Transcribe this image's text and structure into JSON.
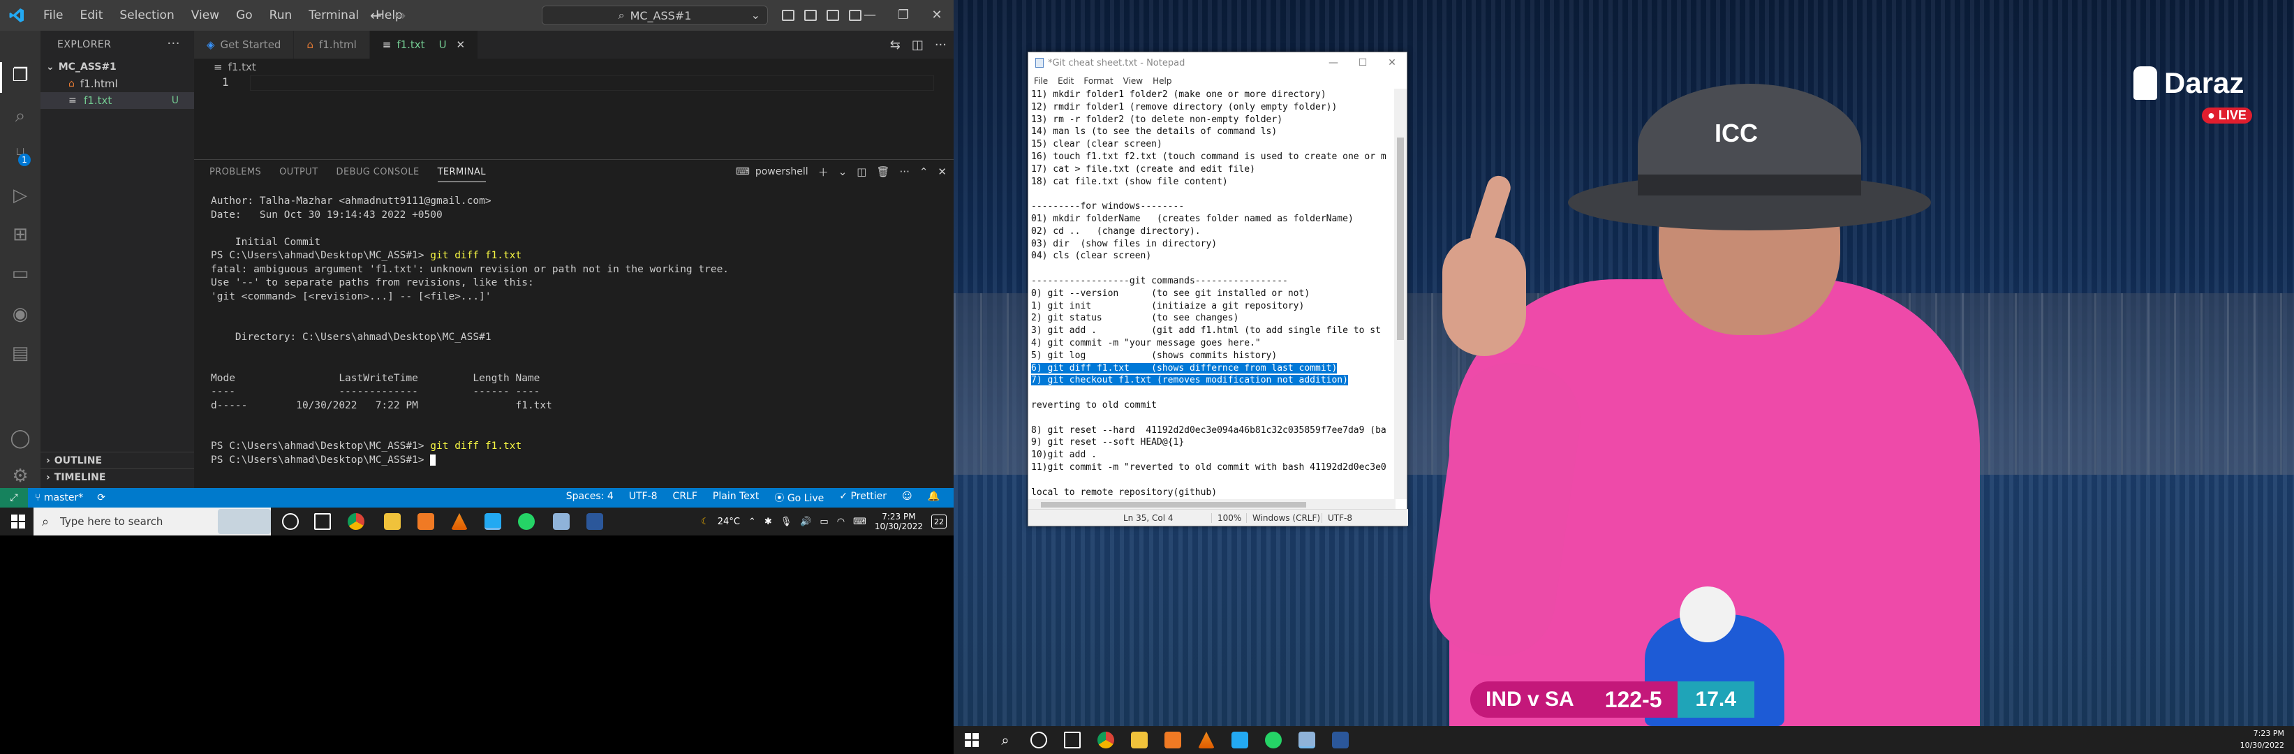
{
  "vscode": {
    "menu": [
      "File",
      "Edit",
      "Selection",
      "View",
      "Go",
      "Run",
      "Terminal",
      "Help"
    ],
    "search_text": "MC_ASS#1",
    "explorer_label": "EXPLORER",
    "folder_name": "MC_ASS#1",
    "files": [
      {
        "name": "f1.html",
        "status": ""
      },
      {
        "name": "f1.txt",
        "status": "U"
      }
    ],
    "outline_label": "OUTLINE",
    "timeline_label": "TIMELINE",
    "tabs": [
      {
        "label": "Get Started",
        "active": false
      },
      {
        "label": "f1.html",
        "active": false
      },
      {
        "label": "f1.txt",
        "status": "U",
        "active": true
      }
    ],
    "breadcrumb": "f1.txt",
    "line_number": "1",
    "source_control_badge": "1",
    "panel_tabs": [
      "PROBLEMS",
      "OUTPUT",
      "DEBUG CONSOLE",
      "TERMINAL"
    ],
    "shell_name": "powershell",
    "terminal_lines": [
      {
        "text": "Author: Talha-Mazhar <ahmadnutt9111@gmail.com>"
      },
      {
        "text": "Date:   Sun Oct 30 19:14:43 2022 +0500"
      },
      {
        "text": ""
      },
      {
        "text": "    Initial Commit"
      },
      {
        "prompt": "PS C:\\Users\\ahmad\\Desktop\\MC_ASS#1> ",
        "cmd": "git diff f1.txt"
      },
      {
        "text": "fatal: ambiguous argument 'f1.txt': unknown revision or path not in the working tree."
      },
      {
        "text": "Use '--' to separate paths from revisions, like this:"
      },
      {
        "text": "'git <command> [<revision>...] -- [<file>...]'"
      },
      {
        "text": ""
      },
      {
        "text": ""
      },
      {
        "text": "    Directory: C:\\Users\\ahmad\\Desktop\\MC_ASS#1"
      },
      {
        "text": ""
      },
      {
        "text": ""
      },
      {
        "text": "Mode                 LastWriteTime         Length Name"
      },
      {
        "text": "----                 -------------         ------ ----"
      },
      {
        "text": "d-----        10/30/2022   7:22 PM                f1.txt"
      },
      {
        "text": ""
      },
      {
        "text": ""
      },
      {
        "prompt": "PS C:\\Users\\ahmad\\Desktop\\MC_ASS#1> ",
        "cmd": "git diff f1.txt"
      },
      {
        "prompt": "PS C:\\Users\\ahmad\\Desktop\\MC_ASS#1> ",
        "cmd": "",
        "cursor": true
      }
    ],
    "status": {
      "branch": "master*",
      "spaces": "Spaces: 4",
      "encoding": "UTF-8",
      "eol": "CRLF",
      "language": "Plain Text",
      "golive": "Go Live",
      "prettier": "Prettier"
    }
  },
  "taskbar_left": {
    "search_placeholder": "Type here to search",
    "weather": "24°C",
    "time": "7:23 PM",
    "date": "10/30/2022",
    "notifications": "22"
  },
  "notepad": {
    "title": "*Git cheat sheet.txt - Notepad",
    "menu": [
      "File",
      "Edit",
      "Format",
      "View",
      "Help"
    ],
    "lines": [
      {
        "t": "11) mkdir folder1 folder2 (make one or more directory)"
      },
      {
        "t": "12) rmdir folder1 (remove directory (only empty folder))"
      },
      {
        "t": "13) rm -r folder2 (to delete non-empty folder)"
      },
      {
        "t": "14) man ls (to see the details of command ls)"
      },
      {
        "t": "15) clear (clear screen)"
      },
      {
        "t": "16) touch f1.txt f2.txt (touch command is used to create one or m"
      },
      {
        "t": "17) cat > file.txt (create and edit file)"
      },
      {
        "t": "18) cat file.txt (show file content)"
      },
      {
        "t": ""
      },
      {
        "t": "---------for windows--------"
      },
      {
        "t": "01) mkdir folderName   (creates folder named as folderName)"
      },
      {
        "t": "02) cd ..   (change directory)."
      },
      {
        "t": "03) dir  (show files in directory)"
      },
      {
        "t": "04) cls (clear screen)"
      },
      {
        "t": ""
      },
      {
        "t": "------------------git commands-----------------"
      },
      {
        "t": "0) git --version      (to see git installed or not)"
      },
      {
        "t": "1) git init           (initiaize a git repository)"
      },
      {
        "t": "2) git status         (to see changes)"
      },
      {
        "t": "3) git add .          (git add f1.html (to add single file to st"
      },
      {
        "t": "4) git commit -m \"your message goes here.\""
      },
      {
        "t": "5) git log            (shows commits history)"
      },
      {
        "t": "6) git diff f1.txt    (shows differnce from last commit)",
        "hl": true
      },
      {
        "t": "7) git checkout f1.txt (removes modification not addition)",
        "hl": true
      },
      {
        "t": ""
      },
      {
        "t": "reverting to old commit"
      },
      {
        "t": ""
      },
      {
        "t": "8) git reset --hard  41192d2d0ec3e094a46b81c32c035859f7ee7da9 (ba"
      },
      {
        "t": "9) git reset --soft HEAD@{1}"
      },
      {
        "t": "10)git add ."
      },
      {
        "t": "11)git commit -m \"reverted to old commit with bash 41192d2d0ec3e0"
      },
      {
        "t": ""
      },
      {
        "t": "local to remote repository(github)"
      }
    ],
    "status": {
      "position": "Ln 35, Col 4",
      "zoom": "100%",
      "eol": "Windows (CRLF)",
      "encoding": "UTF-8"
    }
  },
  "video": {
    "brand": "Daraz",
    "live": "LIVE",
    "hat_logo": "ICC",
    "teams": "IND v SA",
    "score": "122-5",
    "overs": "17.4"
  },
  "taskbar_right": {
    "time": "7:23 PM",
    "date": "10/30/2022"
  },
  "colors": {
    "vscode_bg": "#1e1e1e",
    "statusbar": "#007acc",
    "terminal_cmd": "#f5f543",
    "untracked": "#73c991",
    "notepad_selection": "#0078d7",
    "umpire_shirt": "#ee4aa9"
  }
}
